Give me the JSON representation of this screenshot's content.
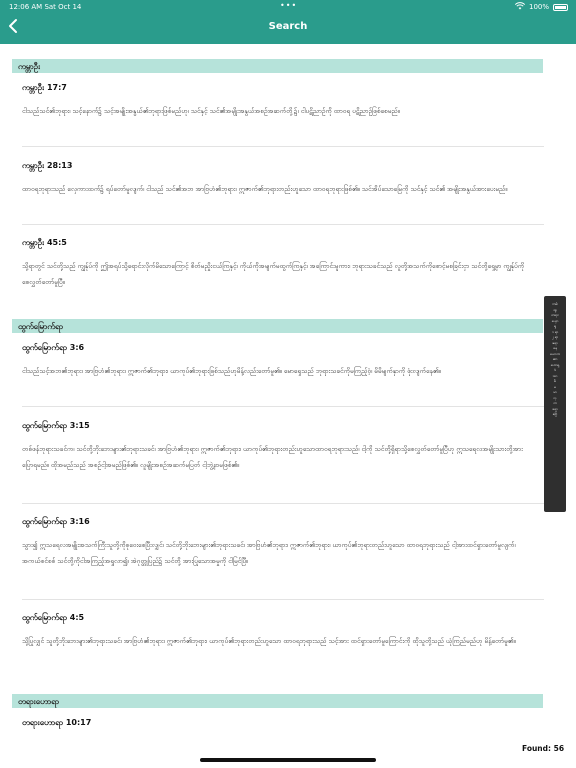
{
  "status_bar": {
    "time": "12:06 AM   Sat Oct 14",
    "dots": "•••",
    "battery": "100%"
  },
  "header": {
    "title": "Search"
  },
  "sections": [
    {
      "name": "ကမ္ဘာဦး",
      "verses": [
        {
          "ref": "ကမ္ဘာဦး 17:7",
          "text": "ငါသည်သင်၏ဘုရား၊ သင့်နောက်၌ သင့်အမျိုးအနွယ်၏ဘုရားဖြစ်မည်ဟု၊ သင်နှင့် သင်၏အမျိုးအနွယ်အစဉ်အဆက်တို့၌၊ ငါပဋိညာဉ်ကို ထာဝရ ပဋိညာဉ်ဖြစ်စေမည်။"
        },
        {
          "ref": "ကမ္ဘာဦး 28:13",
          "text": "ထာဝရဘုရားသည် လှေကားထက်၌ ရပ်တော်မူလျက်၊ ငါသည် သင်၏အဘ အာဗြဟံ၏ဘုရား၊ ဣဇာက်၏ဘုရားတည်းဟူသော ထာဝရဘုရားဖြစ်၏။ သင်အိပ်သောမြေကို သင်နှင့် သင်၏ အမျိုးအနွယ်အားပေးမည်။"
        },
        {
          "ref": "ကမ္ဘာဦး 45:5",
          "text": "သို့ရာတွင် သင်တို့သည် ကျွန်ုပ်ကို ဤအရပ်သို့ရောင်းလိုက်မိသောကြောင့် စိတ်မညှိုးငယ်ကြနှင့်၊ ကိုယ်ကိုအမျက်မထွက်ကြနှင့်၊ အကြောင်းမူကား၊ ဘုရားသခင်သည် လူတို့အသက်ကိုစောင့်မစခြင်းငှာ သင်တို့ရှေ့မှာ ကျွန်ုပ်ကိုစေလွှတ်တော်မူပြီ။"
        }
      ]
    },
    {
      "name": "ထွက်မြောက်ရာ",
      "verses": [
        {
          "ref": "ထွက်မြောက်ရာ 3:6",
          "text": "ငါသည်သင့်အဘ၏ဘုရား၊ အာဗြဟံ၏ဘုရား၊ ဣဇာက်၏ဘုရား၊ ယာကုပ်၏ဘုရားဖြစ်သည်ဟုမိန့်လည်းတော်မူ၏။ မောရှေသည် ဘုရားသခင်ကိုမကြည့်ဝံ့၊ မိမိမျက်နှာကို ဖုံးလျက်နေ၏။"
        },
        {
          "ref": "ထွက်မြောက်ရာ 3:15",
          "text": "တစ်ဖန်ဘုရားသခင်က၊ သင်တို့ဘိုးဘေးများ၏ဘုရားသခင်၊ အာဗြဟံ၏ဘုရား၊ ဣဇာက်၏ဘုရား၊ ယာကုပ်၏ဘုရားတည်းဟူသောထာဝရဘုရားသည်၊ ငါ့ကို သင်တို့ရှိရာသို့စေလွှတ်တော်မူပြီဟု ဣသရေလအမျိုးသားတို့အား ပြောရမည်။ ထိုအမည်သည် အစဉ်ငါ့အမည်ဖြစ်၏။ လူမျိုးအစဉ်အဆက်မပြတ် ငါ့ဘွဲ့နာမဖြစ်၏။"
        },
        {
          "ref": "ထွက်မြောက်ရာ 3:16",
          "text": "သွား၍ ဣသရေလအမျိုးအသက်ကြီးသူတို့ကိုစုဝေးစေပြီးလျှင်၊ သင်တို့ဘိုးဘေးများ၏ဘုရားသခင်၊ အာဗြဟံ၏ဘုရား၊ ဣဇာက်၏ဘုရား၊ ယာကုပ်၏ဘုရားတည်းဟူသော ထာဝရဘုရားသည် ငါ့အားထင်ရှားတော်မူလျက်၊ အကယ်စင်စစ် သင်တို့ကိုငါအကြည့်အရှုလာ၍၊ အဲဂုတ္တုပြည်၌ သင်တို့ အားပြုသောအမှုကို ငါမြင်ပြီ။"
        },
        {
          "ref": "ထွက်မြောက်ရာ 4:5",
          "text": "သို့ပြုလျှင် သူတို့ဘိုးဘေးများ၏ဘုရားသခင်၊ အာဗြဟံ၏ဘုရား၊ ဣဇာက်၏ဘုရား၊ ယာကုပ်၏ဘုရားတည်းဟူသော ထာဝရဘုရားသည် သင့်အား ထင်ရှားတော်မူကြောင်းကို ထိုသူတို့သည် ယုံကြည်မည်ဟု မိန့်တော်မူ၏။"
        }
      ]
    },
    {
      "name": "တရားဟောရာ",
      "verses": [
        {
          "ref": "တရားဟောရာ 10:17",
          "text": ""
        }
      ]
    }
  ],
  "index_items": [
    "ကမ်း",
    "ထွ",
    "တရား",
    "ယှော",
    "ရှု",
    "၁ ရာ",
    "၂ ရာ",
    "ဧရာ",
    "နေ",
    "ယောဘ",
    "ဆာ",
    "ဟောရှ",
    "ဒံ",
    "အာ",
    "မိ",
    "မ",
    "မာ",
    "လု",
    "တ",
    "ရော",
    "ဧဗြ"
  ],
  "footer": {
    "found": "Found:  56"
  }
}
